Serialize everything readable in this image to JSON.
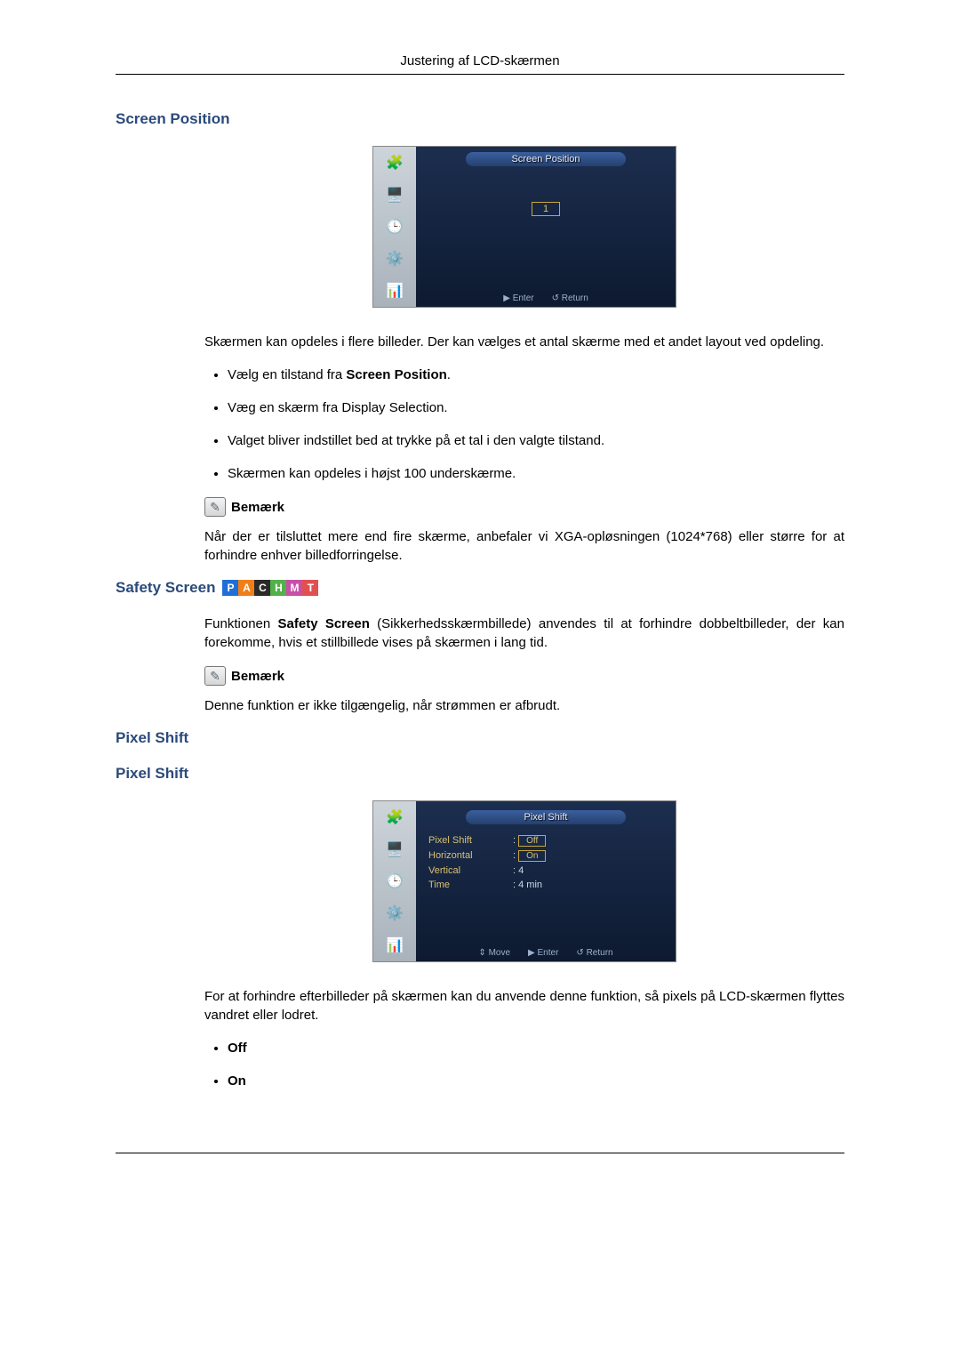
{
  "header": "Justering af LCD-skærmen",
  "sections": {
    "screenPosition": {
      "heading": "Screen Position",
      "menu": {
        "title": "Screen Position",
        "centerValue": "1",
        "enterLabel": "Enter",
        "returnLabel": "Return"
      },
      "intro": "Skærmen kan opdeles i flere billeder. Der kan vælges et antal skærme med et andet layout ved opdeling.",
      "bullets": [
        {
          "prefix": "Vælg en tilstand fra ",
          "bold": "Screen Position",
          "suffix": "."
        },
        {
          "text": "Væg en skærm fra Display Selection."
        },
        {
          "text": "Valget bliver indstillet bed at trykke på et tal i den valgte tilstand."
        },
        {
          "text": "Skærmen kan opdeles i højst 100 underskærme."
        }
      ],
      "noteLabel": "Bemærk",
      "noteText": "Når der er tilsluttet mere end fire skærme, anbefaler vi XGA-opløsningen (1024*768) eller større for at forhindre enhver billedforringelse."
    },
    "safetyScreen": {
      "heading": "Safety Screen",
      "iconLetters": [
        "P",
        "A",
        "C",
        "H",
        "M",
        "T"
      ],
      "intro": {
        "prefix": "Funktionen ",
        "bold": "Safety Screen",
        "suffix": " (Sikkerhedsskærmbillede) anvendes til at forhindre dobbeltbilleder, der kan forekomme, hvis et stillbillede vises på skærmen i lang tid."
      },
      "noteLabel": "Bemærk",
      "noteText": "Denne funktion er ikke tilgængelig, når strømmen er afbrudt."
    },
    "pixelShift": {
      "heading1": "Pixel Shift",
      "heading2": "Pixel Shift",
      "menu": {
        "title": "Pixel Shift",
        "rows": [
          {
            "k": "Pixel Shift",
            "off": "Off",
            "on": "On"
          },
          {
            "k": "Horizontal",
            "v": ""
          },
          {
            "k": "Vertical",
            "v": ": 4"
          },
          {
            "k": "Time",
            "v": ": 4 min"
          }
        ],
        "moveLabel": "Move",
        "enterLabel": "Enter",
        "returnLabel": "Return"
      },
      "intro": "For at forhindre efterbilleder på skærmen kan du anvende denne funktion, så pixels på LCD-skærmen flyttes vandret eller lodret.",
      "bullets": [
        {
          "bold": "Off"
        },
        {
          "bold": "On"
        }
      ]
    }
  }
}
